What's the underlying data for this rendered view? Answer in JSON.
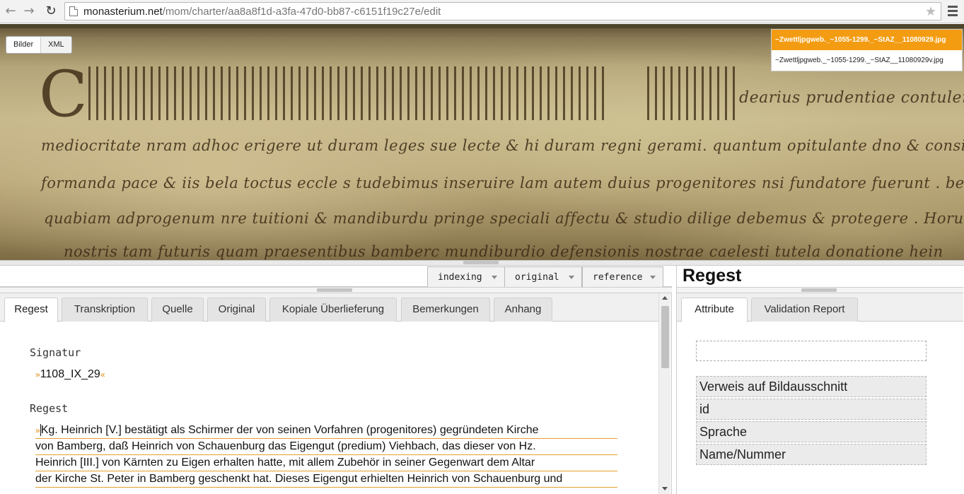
{
  "browser": {
    "url_host": "monasterium.net",
    "url_path": "/mom/charter/aa8a8f1d-a3fa-47d0-bb87-c6151f19c27e/edit"
  },
  "viewer": {
    "toggle": {
      "bilder": "Bilder",
      "xml": "XML"
    },
    "images": [
      "~Zwettljpgweb._~1055-1299._~StAZ__11080929.jpg",
      "~Zwettljpgweb._~1055-1299._~StAZ__11080929v.jpg"
    ],
    "script_lines": [
      "mediocritate nram adhoc erigere ut duram leges sue lecte & hi duram regni gerami. quantum opitulante dno & consilio principum poterimus prore",
      "formanda pace & iis bela toctus eccle s tudebimus inseruire  lam autem duius progenitores nsi fundatore  fuerunt . bebenbergensem lectam",
      "quabiam adprogenum nre tuitioni & mandiburdu pringe speciali affectu & studio dilige debemus & protegere . Horum ergo fieri cupimus",
      "nostris  tam futuris quam praesentibus  bamberc  mundiburdio defensionis  nostrae  caelesti  tutela  donatione hein"
    ],
    "top_line_right": "dearius  prudentiae  contulerunt"
  },
  "toolbar": {
    "dropdowns": [
      "indexing",
      "original",
      "reference"
    ]
  },
  "left_tabs": [
    "Regest",
    "Transkription",
    "Quelle",
    "Original",
    "Kopiale Überlieferung",
    "Bemerkungen",
    "Anhang"
  ],
  "content": {
    "signatur_label": "Signatur",
    "signatur_value": "1108_IX_29",
    "regest_label": "Regest",
    "regest_lines": [
      "Kg. Heinrich [V.] bestätigt als Schirmer der von seinen Vorfahren (progenitores) gegründeten Kirche",
      "von Bamberg, daß Heinrich von Schauenburg das Eigengut (predium) Viehbach, das dieser von Hz.",
      "Heinrich [III.] von Kärnten zu Eigen erhalten hatte, mit allem Zubehör in seiner Gegenwart dem Altar",
      "der Kirche St. Peter in Bamberg geschenkt hat. Dieses Eigengut erhielten Heinrich von Schauenburg und"
    ],
    "quote_open": "»",
    "quote_close": "«"
  },
  "right": {
    "title": "Regest",
    "tabs": [
      "Attribute",
      "Validation Report"
    ],
    "attributes": [
      "Verweis auf Bildausschnitt",
      "id",
      "Sprache",
      "Name/Nummer"
    ]
  }
}
